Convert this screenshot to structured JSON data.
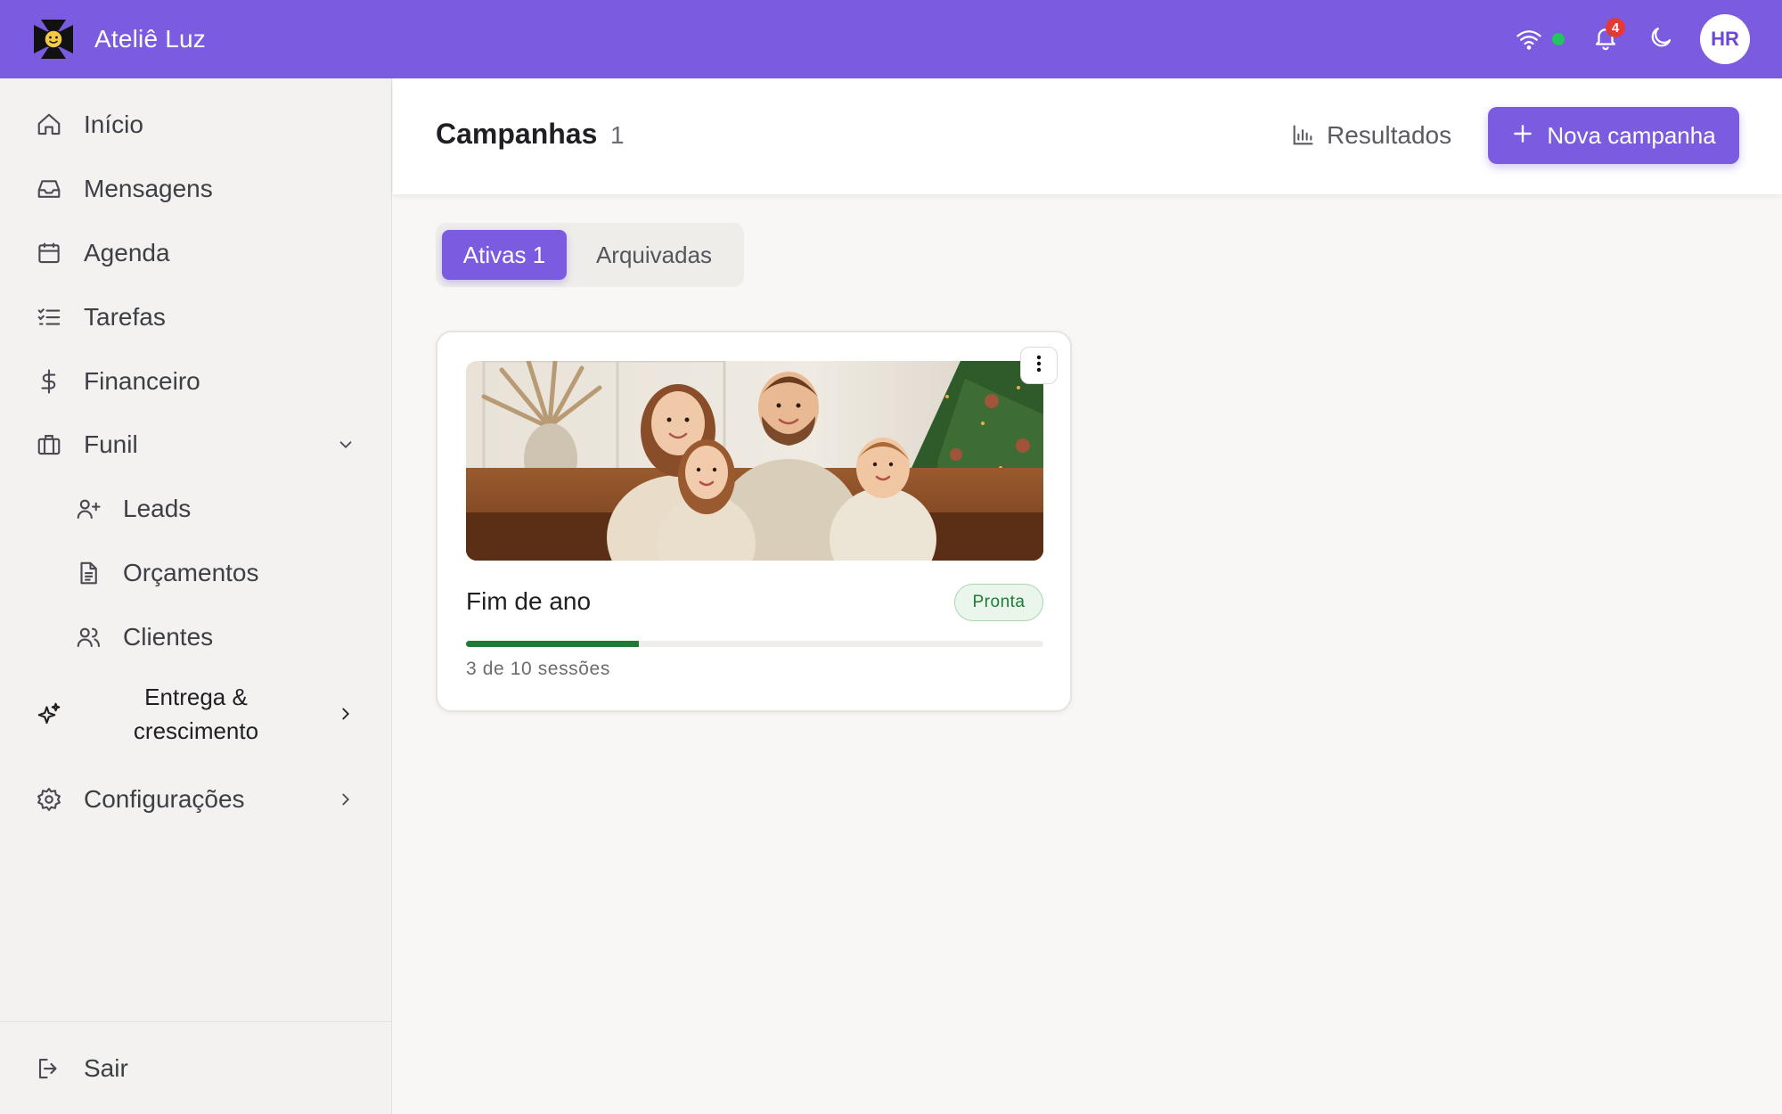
{
  "app": {
    "name": "Ateliê Luz",
    "user_initials": "HR",
    "notification_count": "4",
    "online": true
  },
  "sidebar": {
    "items": [
      {
        "label": "Início",
        "icon": "home-icon"
      },
      {
        "label": "Mensagens",
        "icon": "inbox-icon"
      },
      {
        "label": "Agenda",
        "icon": "calendar-icon"
      },
      {
        "label": "Tarefas",
        "icon": "tasks-icon"
      },
      {
        "label": "Financeiro",
        "icon": "dollar-icon"
      },
      {
        "label": "Funil",
        "icon": "briefcase-icon",
        "expanded": true
      },
      {
        "label": "Leads",
        "icon": "user-plus-icon"
      },
      {
        "label": "Orçamentos",
        "icon": "document-icon"
      },
      {
        "label": "Clientes",
        "icon": "users-icon"
      },
      {
        "label": "Entrega & crescimento",
        "icon": "sparkles-icon"
      },
      {
        "label": "Configurações",
        "icon": "gear-icon"
      }
    ],
    "logout_label": "Sair"
  },
  "header": {
    "title": "Campanhas",
    "count": "1",
    "results_label": "Resultados",
    "new_label": "Nova campanha"
  },
  "tabs": [
    {
      "label": "Ativas 1",
      "active": true
    },
    {
      "label": "Arquivadas",
      "active": false
    }
  ],
  "campaigns": [
    {
      "title": "Fim de ano",
      "status": "Pronta",
      "progress_text": "3 de 10 sessões",
      "progress_fraction": 0.3
    }
  ],
  "colors": {
    "accent": "#7b5be0",
    "success": "#1e7a35",
    "danger": "#e53935"
  }
}
